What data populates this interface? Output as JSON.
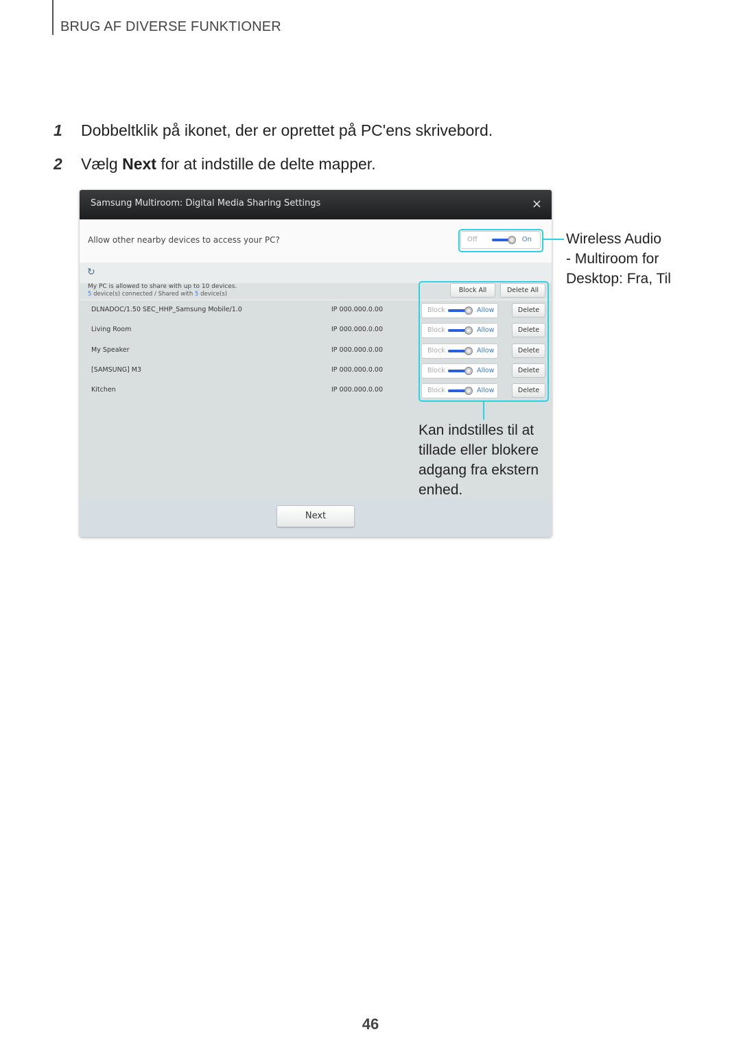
{
  "header": {
    "section_title": "BRUG AF DIVERSE FUNKTIONER"
  },
  "steps": [
    {
      "number": "1",
      "text": "Dobbeltklik på ikonet, der er oprettet på PC'ens skrivebord."
    },
    {
      "number": "2",
      "text_before": "Vælg ",
      "bold": "Next",
      "text_after": " for at indstille de delte mapper."
    }
  ],
  "window": {
    "title": "Samsung Multiroom: Digital Media Sharing Settings",
    "close_icon": "×",
    "question": "Allow other nearby devices to access your PC?",
    "access_toggle": {
      "off_label": "Off",
      "on_label": "On",
      "state": "On"
    },
    "refresh_icon": "↻",
    "info_line1": "My PC is allowed to share with up to 10 devices.",
    "info_connected_count": "5",
    "info_connected_text": " device(s) connected / Shared with ",
    "info_shared_count": "5",
    "info_shared_text": " device(s)",
    "block_all_label": "Block All",
    "delete_all_label": "Delete All",
    "devices": [
      {
        "name": "DLNADOC/1.50 SEC_HHP_Samsung Mobile/1.0",
        "ip": "IP 000.000.0.00",
        "block_label": "Block",
        "allow_label": "Allow",
        "state": "Allow",
        "delete_label": "Delete"
      },
      {
        "name": "Living Room",
        "ip": "IP 000.000.0.00",
        "block_label": "Block",
        "allow_label": "Allow",
        "state": "Allow",
        "delete_label": "Delete"
      },
      {
        "name": "My Speaker",
        "ip": "IP 000.000.0.00",
        "block_label": "Block",
        "allow_label": "Allow",
        "state": "Allow",
        "delete_label": "Delete"
      },
      {
        "name": "[SAMSUNG] M3",
        "ip": "IP 000.000.0.00",
        "block_label": "Block",
        "allow_label": "Allow",
        "state": "Allow",
        "delete_label": "Delete"
      },
      {
        "name": "Kitchen",
        "ip": "IP 000.000.0.00",
        "block_label": "Block",
        "allow_label": "Allow",
        "state": "Allow",
        "delete_label": "Delete"
      }
    ],
    "next_label": "Next"
  },
  "callouts": {
    "toggle_note": [
      "Wireless Audio",
      "- Multiroom for",
      "Desktop: Fra, Til"
    ],
    "rows_note": [
      "Kan indstilles til at",
      "tillade eller blokere",
      "adgang fra ekstern",
      "enhed."
    ],
    "highlight_color": "#2ad3e4"
  },
  "page_number": "46"
}
